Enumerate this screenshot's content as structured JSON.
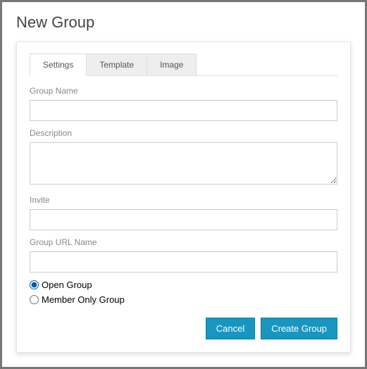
{
  "title": "New Group",
  "tabs": [
    {
      "label": "Settings",
      "active": true
    },
    {
      "label": "Template",
      "active": false
    },
    {
      "label": "Image",
      "active": false
    }
  ],
  "fields": {
    "group_name": {
      "label": "Group Name",
      "value": ""
    },
    "description": {
      "label": "Description",
      "value": ""
    },
    "invite": {
      "label": "Invite",
      "value": ""
    },
    "url_name": {
      "label": "Group URL Name",
      "value": ""
    }
  },
  "visibility": {
    "open": {
      "label": "Open Group",
      "checked": true
    },
    "member_only": {
      "label": "Member Only Group",
      "checked": false
    }
  },
  "actions": {
    "cancel": "Cancel",
    "create": "Create Group"
  }
}
